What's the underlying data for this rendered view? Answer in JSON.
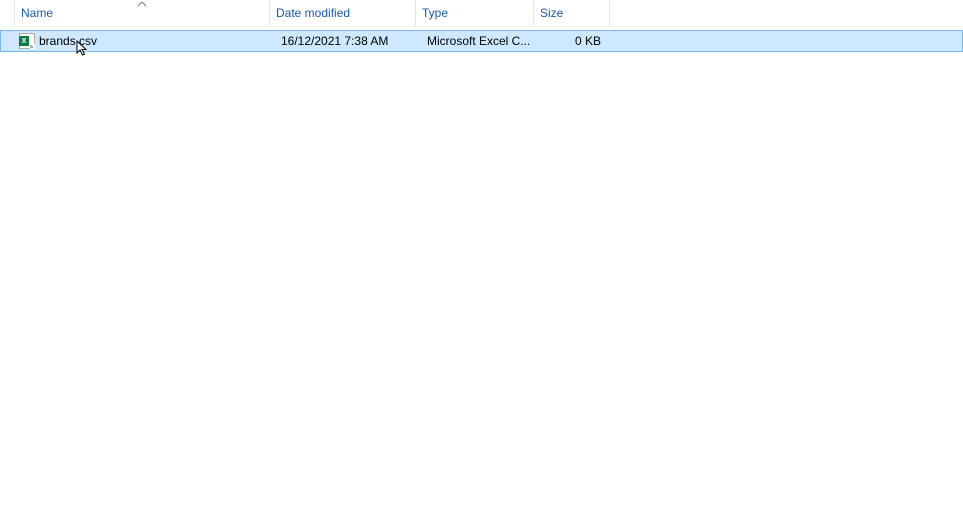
{
  "columns": {
    "name": "Name",
    "date": "Date modified",
    "type": "Type",
    "size": "Size"
  },
  "files": [
    {
      "name": "brands.csv",
      "date": "16/12/2021 7:38 AM",
      "type": "Microsoft Excel C...",
      "size": "0 KB",
      "icon": "excel-csv",
      "selected": true
    }
  ]
}
